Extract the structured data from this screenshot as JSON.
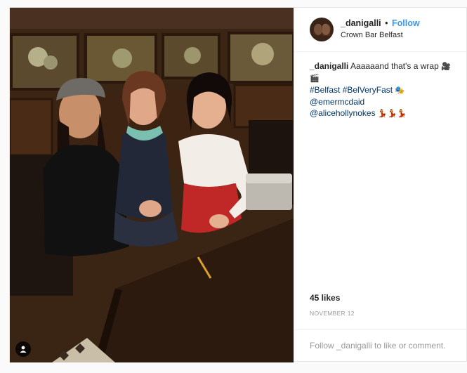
{
  "post": {
    "author": {
      "username": "_danigalli",
      "follow_label": "Follow",
      "separator": "•",
      "location": "Crown Bar Belfast"
    },
    "caption": {
      "username": "_danigalli",
      "text": "Aaaaaand that's a wrap",
      "emoji_1": "🎥🎬",
      "hashtag_1": "#Belfast",
      "hashtag_2": "#BelVeryFast",
      "emoji_2": "🎭",
      "mention_1": "@emermcdaid",
      "mention_2": "@alicehollynokes",
      "emoji_3": "💃💃💃"
    },
    "likes": "45 likes",
    "date": "November 12",
    "footer": {
      "login_prompt": "Follow _danigalli to like or comment."
    }
  },
  "colors": {
    "link_blue": "#3897f0",
    "hashtag_navy": "#003569",
    "muted_grey": "#999999",
    "text_dark": "#262626"
  },
  "icons": {
    "user_tag": "person-tag-icon"
  }
}
